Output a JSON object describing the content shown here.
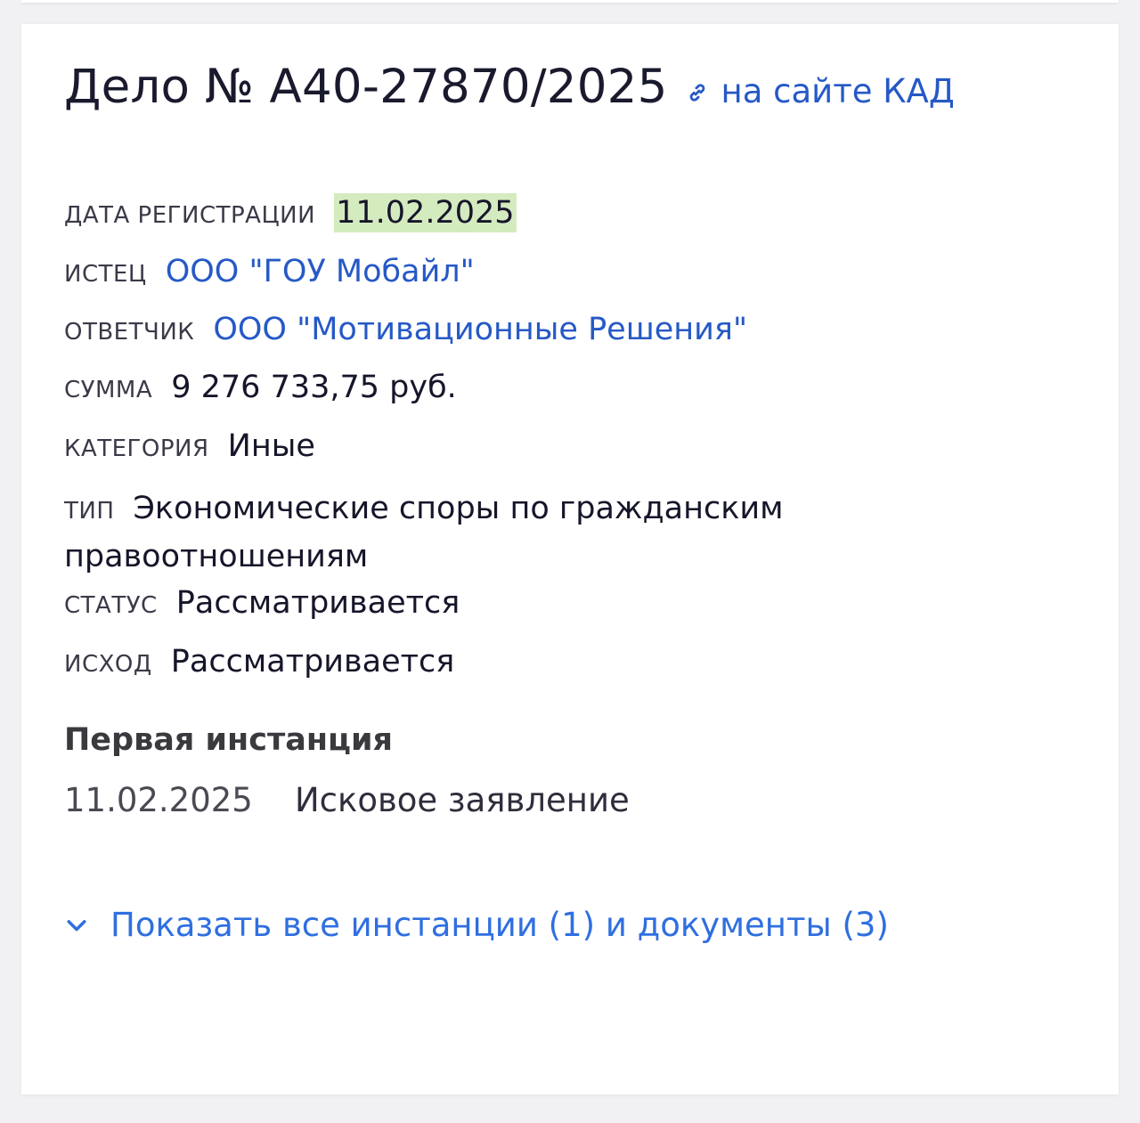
{
  "case": {
    "title": "Дело № А40-27870/2025",
    "kad_link": "на сайте КАД"
  },
  "fields": {
    "registration_date": {
      "label": "ДАТА РЕГИСТРАЦИИ",
      "value": "11.02.2025"
    },
    "plaintiff": {
      "label": "ИСТЕЦ",
      "value": "ООО \"ГОУ Мобайл\""
    },
    "defendant": {
      "label": "ОТВЕТЧИК",
      "value": "ООО \"Мотивационные Решения\""
    },
    "amount": {
      "label": "СУММА",
      "value": "9 276 733,75 руб."
    },
    "category": {
      "label": "КАТЕГОРИЯ",
      "value": "Иные"
    },
    "type": {
      "label": "ТИП",
      "value": "Экономические споры по гражданским правоотношениям"
    },
    "status": {
      "label": "СТАТУС",
      "value": "Рассматривается"
    },
    "outcome": {
      "label": "ИСХОД",
      "value": "Рассматривается"
    }
  },
  "first_instance": {
    "title": "Первая инстанция",
    "date": "11.02.2025",
    "document": "Исковое заявление"
  },
  "show_all": {
    "label": "Показать все инстанции (1) и документы (3)"
  },
  "icons": {
    "link": "link-icon",
    "expand": "chevron-down-icon"
  },
  "colors": {
    "link": "#2659c6",
    "date_highlight": "#d4ebbf",
    "show_all": "#2f6fe0"
  }
}
